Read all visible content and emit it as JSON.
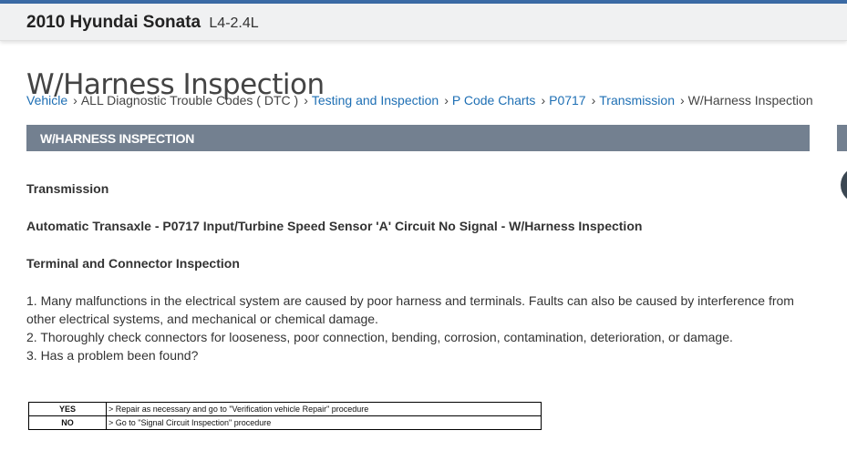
{
  "vehicle": {
    "model": "2010 Hyundai Sonata",
    "engine": "L4-2.4L"
  },
  "page_title": "W/Harness Inspection",
  "breadcrumb": [
    {
      "label": "Vehicle",
      "link": true
    },
    {
      "label": "ALL Diagnostic Trouble Codes ( DTC )",
      "link": false
    },
    {
      "label": "Testing and Inspection",
      "link": true
    },
    {
      "label": "P Code Charts",
      "link": true
    },
    {
      "label": "P0717",
      "link": true
    },
    {
      "label": "Transmission",
      "link": true
    },
    {
      "label": "W/Harness Inspection",
      "link": false
    }
  ],
  "section": {
    "title": "W/HARNESS INSPECTION"
  },
  "content": {
    "system": "Transmission",
    "heading": "Automatic Transaxle - P0717 Input/Turbine Speed Sensor 'A' Circuit No Signal - W/Harness Inspection",
    "subheading": "Terminal and Connector Inspection",
    "steps": [
      " 1. Many malfunctions in the electrical system are caused by poor harness and terminals. Faults can also be caused by interference from other electrical systems, and mechanical or chemical damage.",
      " 2. Thoroughly check connectors for looseness, poor connection, bending, corrosion, contamination, deterioration, or damage.",
      " 3. Has a problem been found?"
    ]
  },
  "decision_table": [
    {
      "answer": "YES",
      "action": "> Repair as necessary and go to \"Verification vehicle Repair\" procedure"
    },
    {
      "answer": "NO",
      "action": "> Go to \"Signal Circuit Inspection\" procedure"
    }
  ],
  "colors": {
    "accent": "#3a6aa5",
    "section_band": "#738090",
    "link": "#1e6fb4"
  }
}
